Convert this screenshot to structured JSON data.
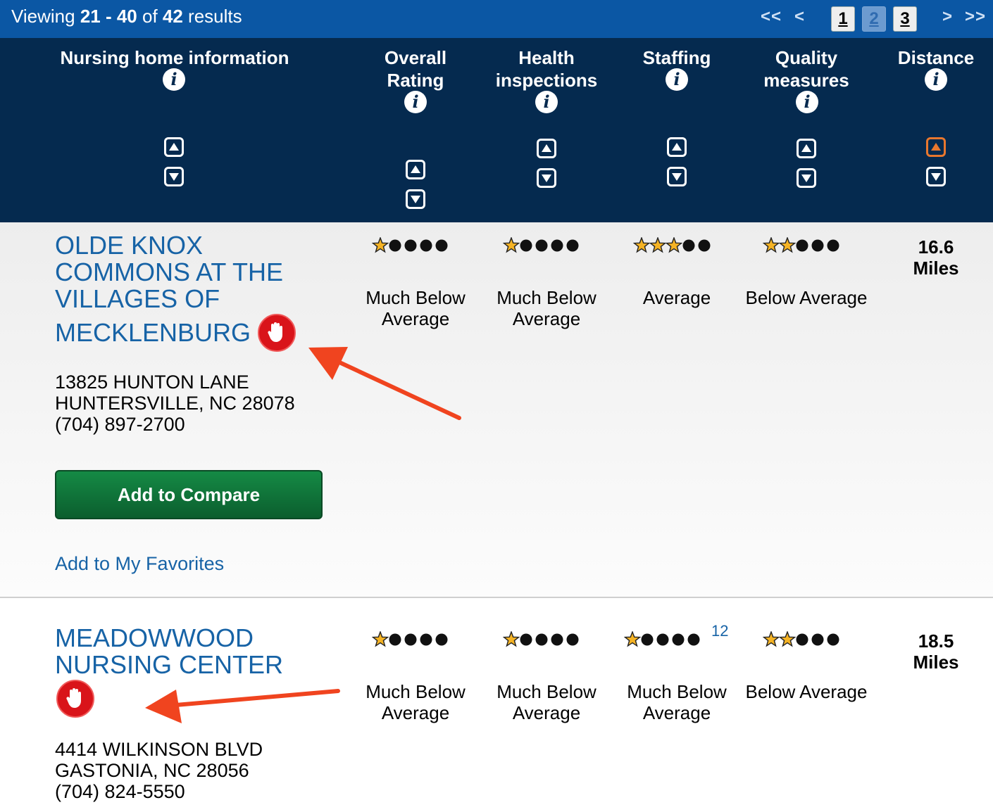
{
  "topbar": {
    "viewing_prefix": "Viewing ",
    "range_start": "21",
    "range_sep": " - ",
    "range_end": "40",
    "of_text": " of ",
    "total": "42",
    "results_text": " results",
    "pager": {
      "first": "<<",
      "prev": "<",
      "pages": [
        "1",
        "2",
        "3"
      ],
      "current_page": "2",
      "next": ">",
      "last": ">>"
    }
  },
  "header": {
    "columns": [
      {
        "title_lines": [
          "Nursing home information"
        ]
      },
      {
        "title_lines": [
          "Overall",
          "Rating"
        ]
      },
      {
        "title_lines": [
          "Health",
          "inspections"
        ]
      },
      {
        "title_lines": [
          "Staffing"
        ]
      },
      {
        "title_lines": [
          "Quality",
          "measures"
        ]
      },
      {
        "title_lines": [
          "Distance"
        ]
      }
    ],
    "info_icon_glyph": "i",
    "active_sort": "distance-ascending"
  },
  "facilities": [
    {
      "name_lines": [
        "OLDE KNOX",
        "COMMONS AT THE",
        "VILLAGES OF",
        "MECKLENBURG"
      ],
      "address_lines": [
        "13825 HUNTON LANE",
        "HUNTERSVILLE, NC 28078",
        "(704) 897-2700"
      ],
      "compare_label": "Add to Compare",
      "favorites_label": "Add to My Favorites",
      "ratings": [
        {
          "stars": 1,
          "label_lines": [
            "Much Below",
            "Average"
          ]
        },
        {
          "stars": 1,
          "label_lines": [
            "Much Below",
            "Average"
          ]
        },
        {
          "stars": 3,
          "label_lines": [
            "Average"
          ]
        },
        {
          "stars": 2,
          "label_lines": [
            "Below Average"
          ]
        }
      ],
      "distance_value": "16.6",
      "distance_unit": "Miles",
      "stop_icon": "stop-hand-icon"
    },
    {
      "name_lines": [
        "MEADOWWOOD",
        "NURSING CENTER"
      ],
      "address_lines": [
        "4414 WILKINSON BLVD",
        "GASTONIA, NC 28056",
        "(704) 824-5550"
      ],
      "ratings": [
        {
          "stars": 1,
          "label_lines": [
            "Much Below",
            "Average"
          ]
        },
        {
          "stars": 1,
          "label_lines": [
            "Much Below",
            "Average"
          ]
        },
        {
          "stars": 1,
          "label_lines": [
            "Much Below",
            "Average"
          ],
          "footnote": "12"
        },
        {
          "stars": 2,
          "label_lines": [
            "Below Average"
          ]
        }
      ],
      "distance_value": "18.5",
      "distance_unit": "Miles",
      "stop_icon": "stop-hand-icon"
    }
  ],
  "colors": {
    "topbar": "#0b57a4",
    "header": "#052a4f",
    "link": "#1763a6",
    "star_fill": "#f5b324",
    "compare_button": "#0f7a3c",
    "stop_icon": "#d9141a",
    "annotation_arrow": "#f0441f",
    "active_sort": "#e8772e"
  }
}
